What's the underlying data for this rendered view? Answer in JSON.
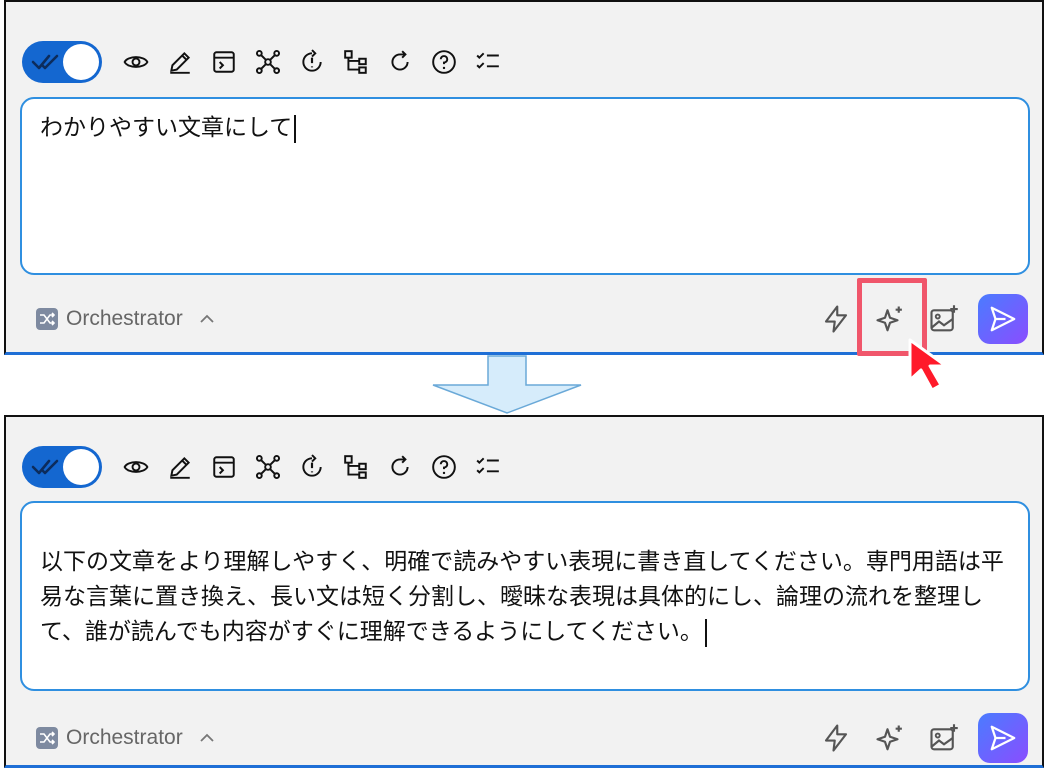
{
  "before": {
    "input_text": "わかりやすい文章にして",
    "mode_label": "Orchestrator"
  },
  "after": {
    "input_text": "以下の文章をより理解しやすく、明確で読みやすい表現に書き直してください。専門用語は平易な言葉に置き換え、長い文は短く分割し、曖昧な表現は具体的にし、論理の流れを整理して、誰が読んでも内容がすぐに理解できるようにしてください。",
    "mode_label": "Orchestrator"
  },
  "toolbar_icons": [
    "auto-approve-toggle",
    "eye-icon",
    "pencil-icon",
    "terminal-icon",
    "nodes-icon",
    "refresh-alert-icon",
    "tree-icon",
    "reload-icon",
    "help-icon",
    "checklist-icon"
  ],
  "footer_icons": [
    "lightning-icon",
    "sparkle-enhance-icon",
    "add-image-icon",
    "send-icon"
  ],
  "colors": {
    "accent": "#1467d0",
    "highlight": "#f0566b",
    "editor_border": "#2f8fe0"
  }
}
